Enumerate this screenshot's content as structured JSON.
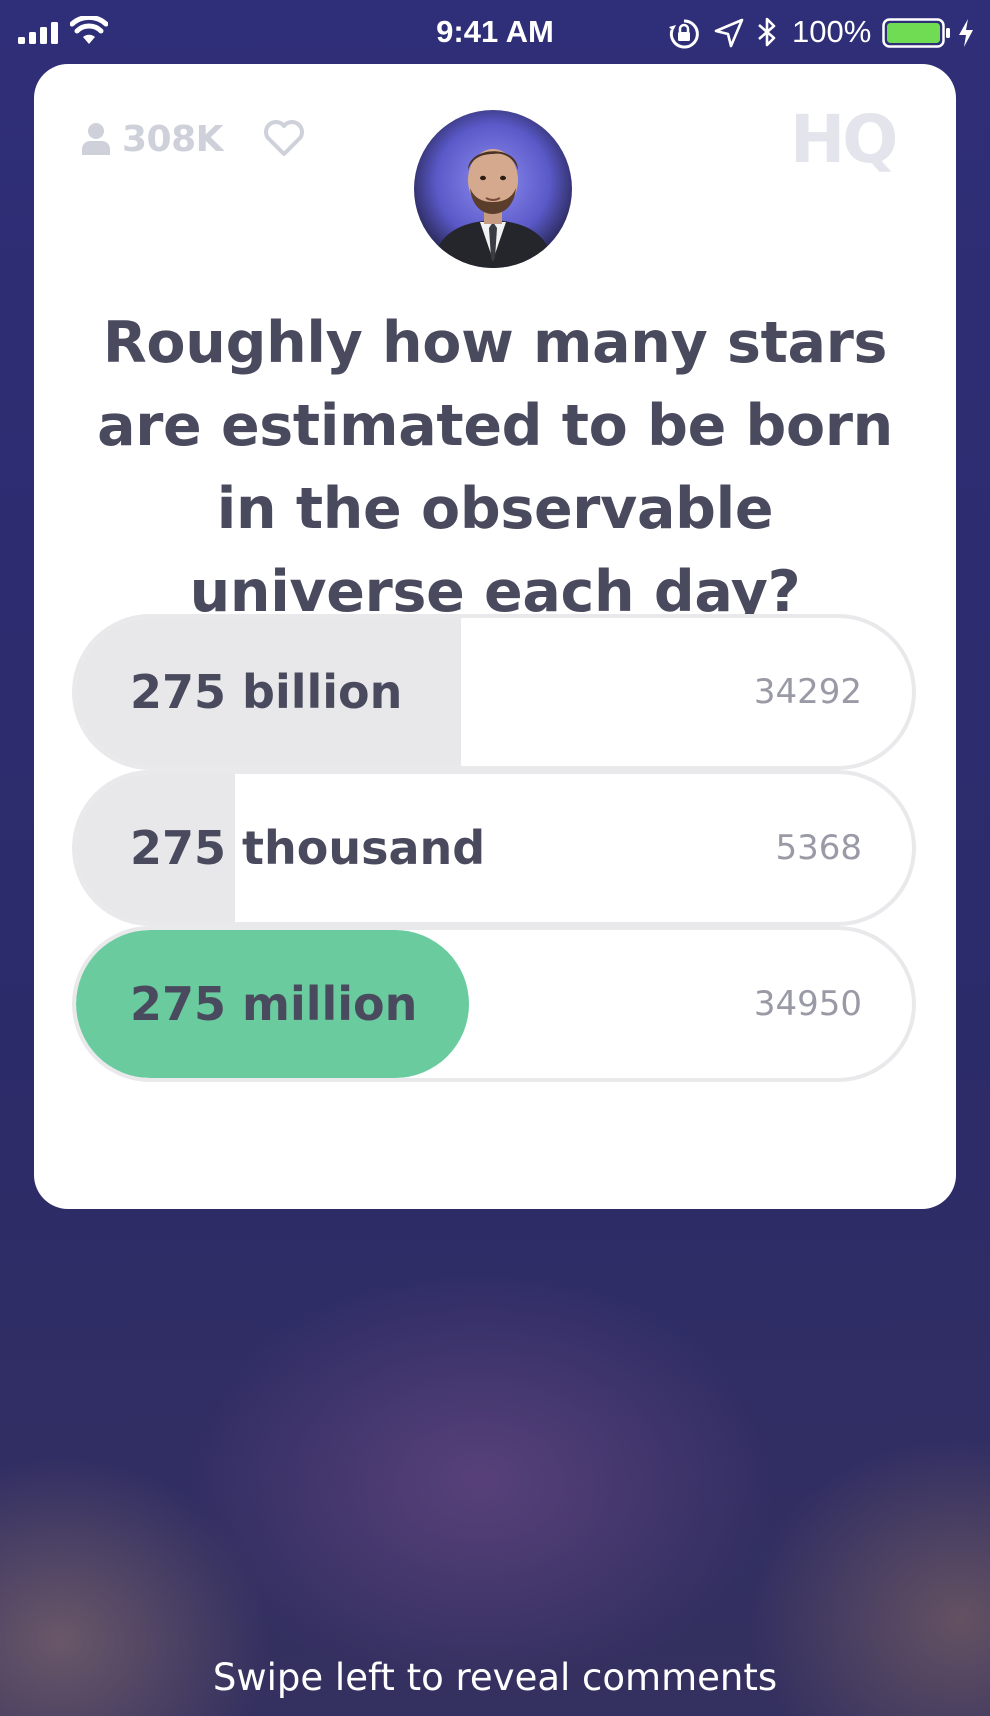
{
  "status_bar": {
    "time": "9:41 AM",
    "battery_percent": "100%",
    "battery_level": 1.0,
    "battery_color": "#6fdc53",
    "icons": [
      "signal-icon",
      "wifi-icon",
      "orientation-lock-icon",
      "location-icon",
      "bluetooth-icon",
      "battery-icon",
      "charging-icon"
    ]
  },
  "header": {
    "viewer_count": "308K",
    "logo_text": "HQ"
  },
  "question": "Roughly how many stars are estimated to be born in the observable universe each day?",
  "answers": [
    {
      "label": "275 billion",
      "count": "34292",
      "share": 0.46,
      "correct": false
    },
    {
      "label": "275 thousand",
      "count": "5368",
      "share": 0.19,
      "correct": false
    },
    {
      "label": "275 million",
      "count": "34950",
      "share": 0.47,
      "correct": true
    }
  ],
  "colors": {
    "background": "#2f2e78",
    "card": "#ffffff",
    "correct": "#6acb9e",
    "answer_fill": "#e8e8ea",
    "text": "#4a4a5e"
  },
  "footer": {
    "hint": "Swipe left to reveal comments"
  }
}
